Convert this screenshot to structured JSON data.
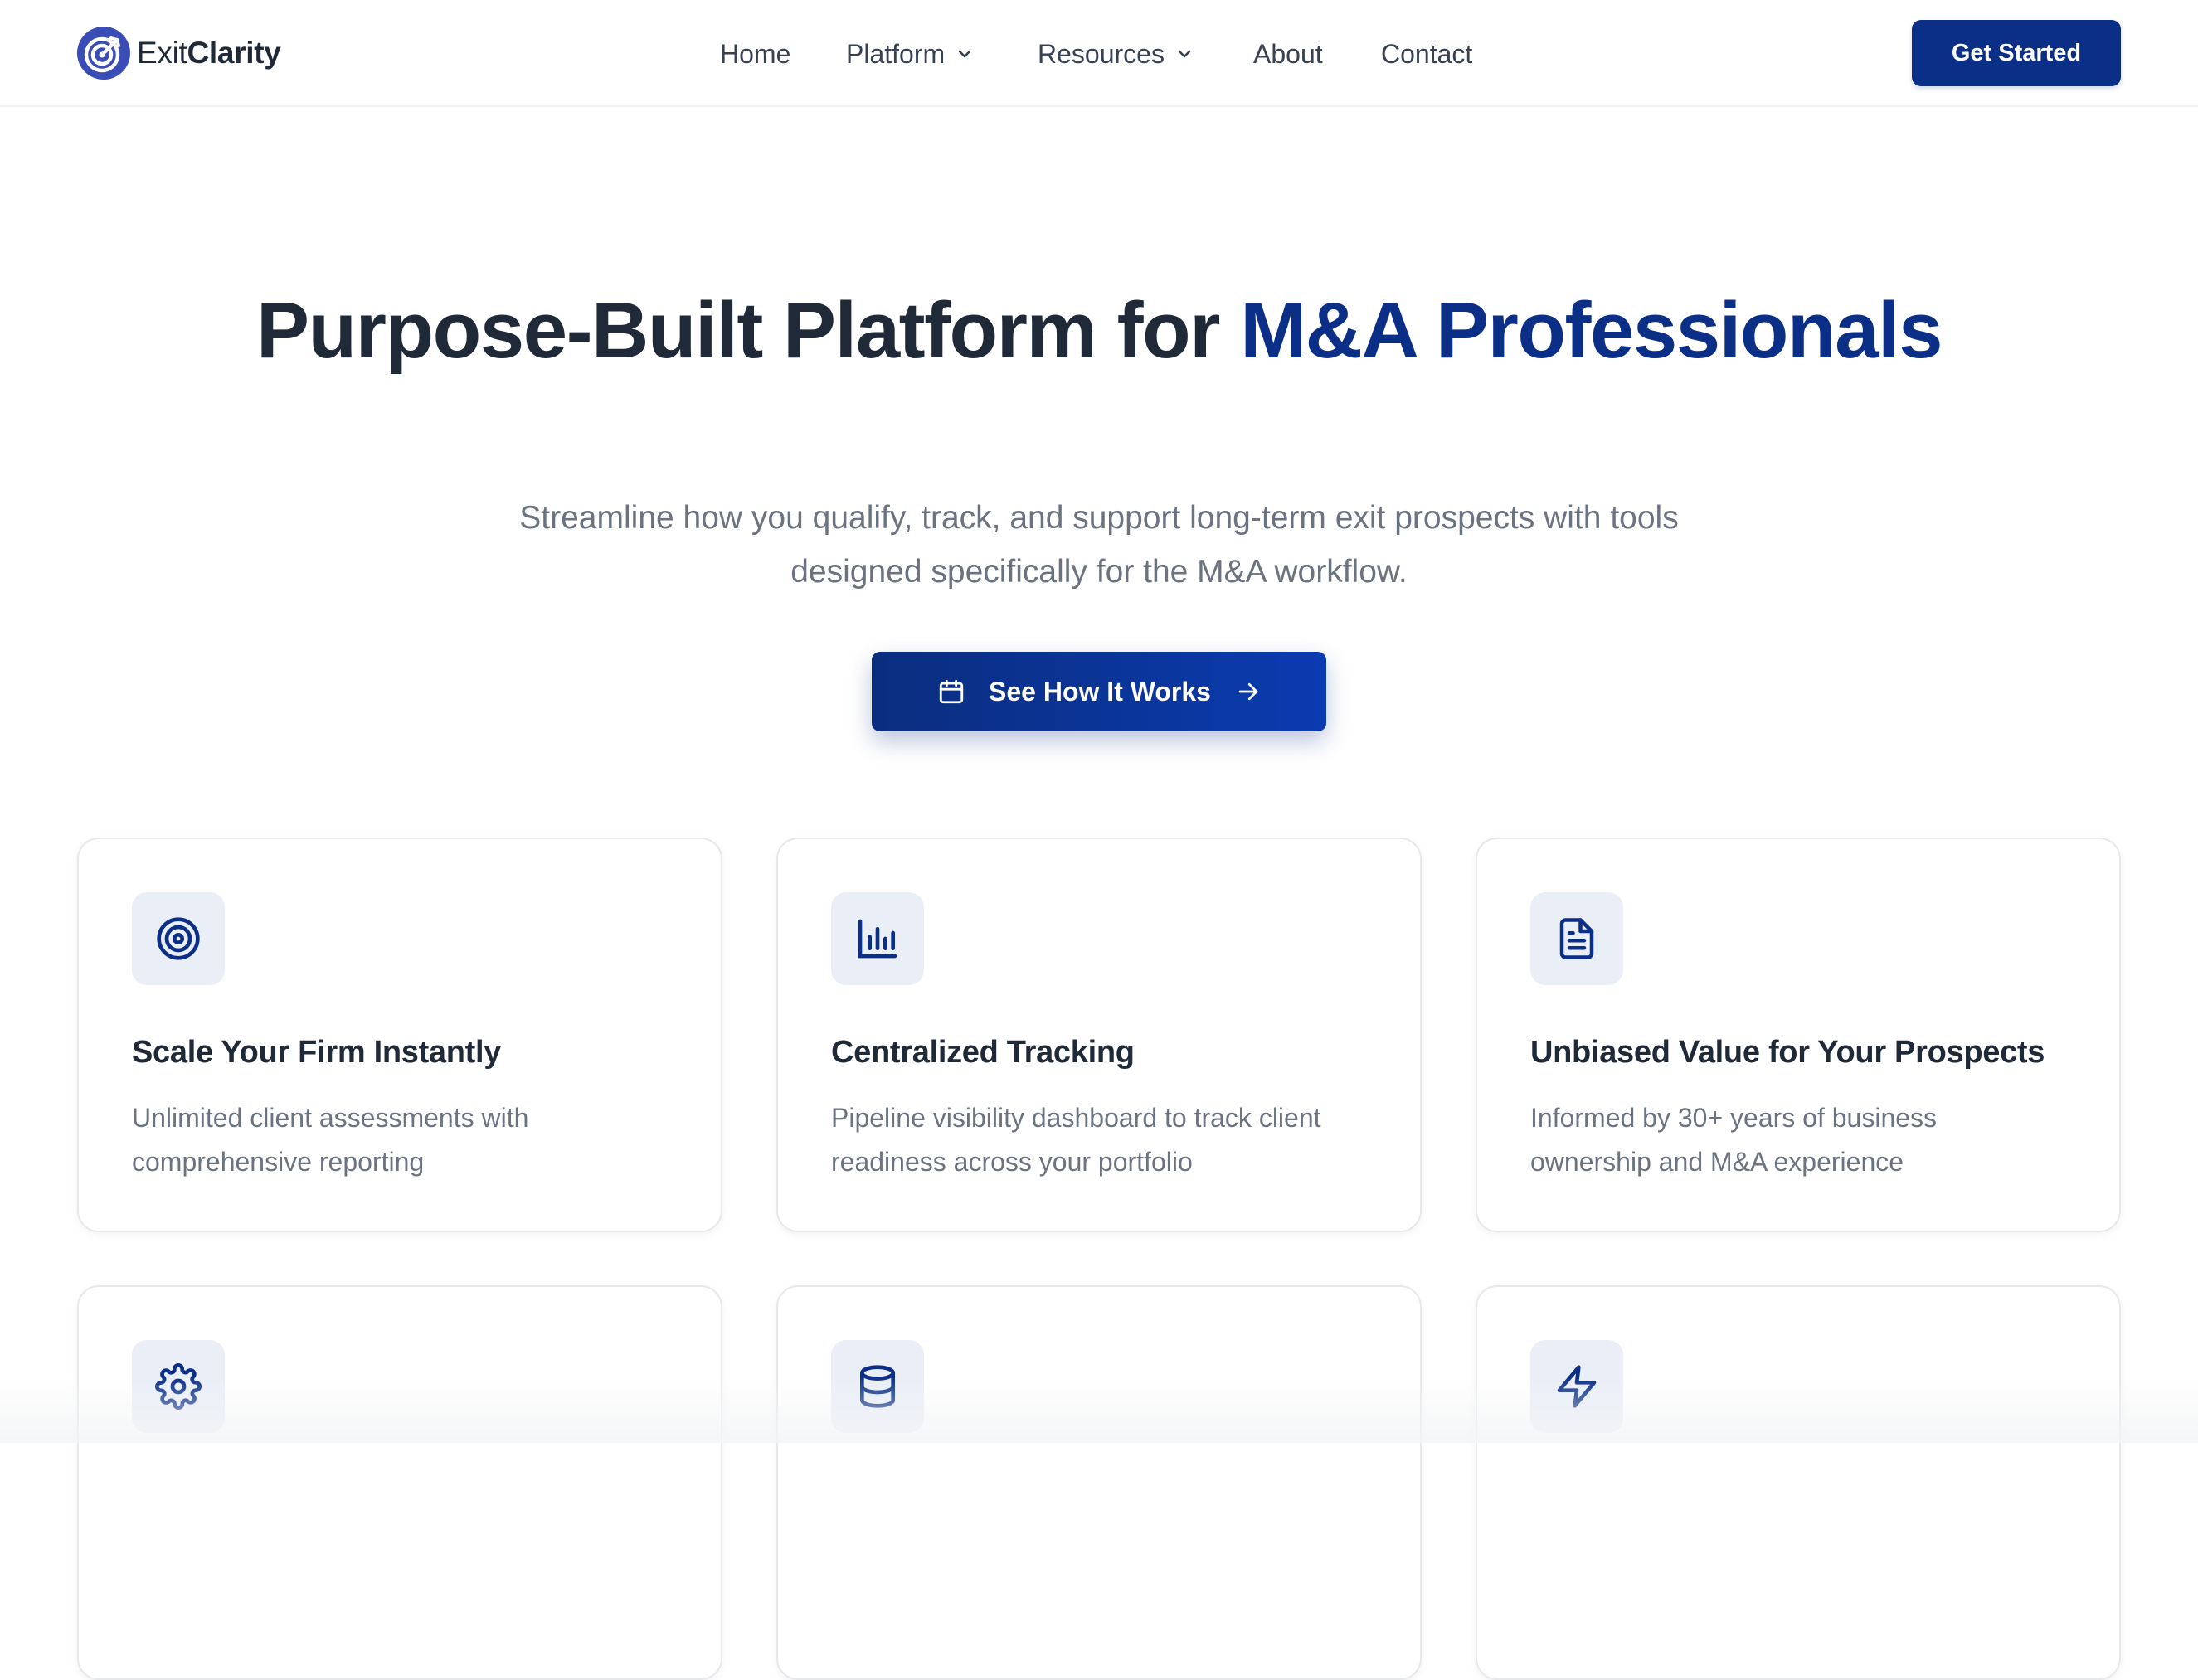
{
  "brand": {
    "name_light": "Exit",
    "name_bold": "Clarity",
    "icon": "target-logo-icon",
    "color": "#3a4cb5"
  },
  "nav": {
    "items": [
      {
        "label": "Home",
        "has_dropdown": false
      },
      {
        "label": "Platform",
        "has_dropdown": true
      },
      {
        "label": "Resources",
        "has_dropdown": true
      },
      {
        "label": "About",
        "has_dropdown": false
      },
      {
        "label": "Contact",
        "has_dropdown": false
      }
    ],
    "cta_label": "Get Started"
  },
  "hero": {
    "title_main": "Purpose-Built Platform for ",
    "title_accent": "M&A Professionals",
    "subtitle": "Streamline how you qualify, track, and support long-term exit prospects with tools designed specifically for the M&A workflow.",
    "cta_label": "See How It Works",
    "cta_icon_left": "calendar-icon",
    "cta_icon_right": "arrow-right-icon"
  },
  "features": [
    {
      "icon": "target-icon",
      "title": "Scale Your Firm Instantly",
      "description": "Unlimited client assessments with comprehensive reporting"
    },
    {
      "icon": "bar-chart-icon",
      "title": "Centralized Tracking",
      "description": "Pipeline visibility dashboard to track client readiness across your portfolio"
    },
    {
      "icon": "document-icon",
      "title": "Unbiased Value for Your Prospects",
      "description": "Informed by 30+ years of business ownership and M&A experience"
    },
    {
      "icon": "gear-icon",
      "title": "",
      "description": ""
    },
    {
      "icon": "database-icon",
      "title": "",
      "description": ""
    },
    {
      "icon": "lightning-icon",
      "title": "",
      "description": ""
    }
  ],
  "colors": {
    "primary": "#0b2f86",
    "text_dark": "#1f2937",
    "text_muted": "#6b7280",
    "icon_tile": "#eaeef7"
  }
}
